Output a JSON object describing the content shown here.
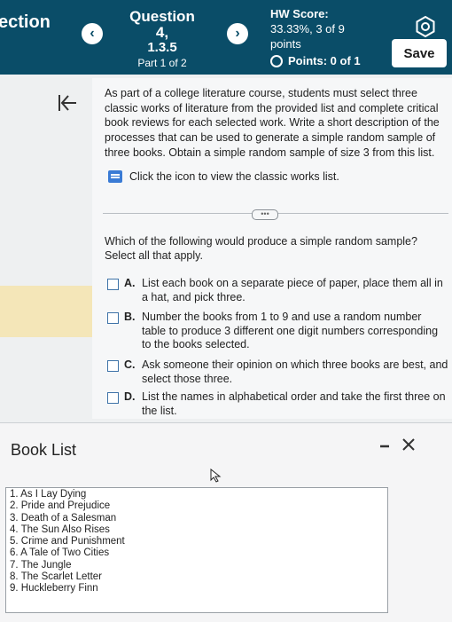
{
  "header": {
    "section_title": "ection",
    "question_title": "Question 4,",
    "question_number": "1.3.5",
    "part": "Part 1 of 2",
    "prev_label": "‹",
    "next_label": "›",
    "hw_score_label": "HW Score:",
    "hw_score_value": "33.33%, 3 of 9",
    "hw_score_unit": "points",
    "points_text": "Points: 0 of 1",
    "save_label": "Save"
  },
  "content": {
    "intro": "As part of a college literature course, students must select three classic works of literature from the provided list and complete critical book reviews for each selected work. Write a short description of the processes that can be used to generate a simple random sample of three books. Obtain a simple random sample of size 3 from this list.",
    "resource_link": "Click the icon to view the classic works list.",
    "more_label": "•••",
    "question": "Which of the following would produce a simple random sample? Select all that apply.",
    "options": [
      {
        "letter": "A.",
        "text": "List each book on a separate piece of paper, place them all in a hat, and pick three."
      },
      {
        "letter": "B.",
        "text": "Number the books from 1 to 9 and use a random number table to produce 3 different one digit numbers corresponding to the books selected."
      },
      {
        "letter": "C.",
        "text": "Ask someone their opinion on which three books are best, and select those three."
      },
      {
        "letter": "D.",
        "text": "List the names in alphabetical order and take the first three on the list."
      }
    ]
  },
  "book_panel": {
    "title": "Book List",
    "minimize_label": "–",
    "close_label": "✕",
    "books": [
      "1. As I Lay Dying",
      "2. Pride and Prejudice",
      "3. Death of a Salesman",
      "4. The Sun Also Rises",
      "5. Crime and Punishment",
      "6. A Tale of Two Cities",
      "7. The Jungle",
      "8. The Scarlet Letter",
      "9. Huckleberry Finn"
    ]
  },
  "colors": {
    "header_bg": "#0a4d68",
    "checkbox_border": "#3f73a8",
    "highlight_strip": "#f4e6b8"
  }
}
